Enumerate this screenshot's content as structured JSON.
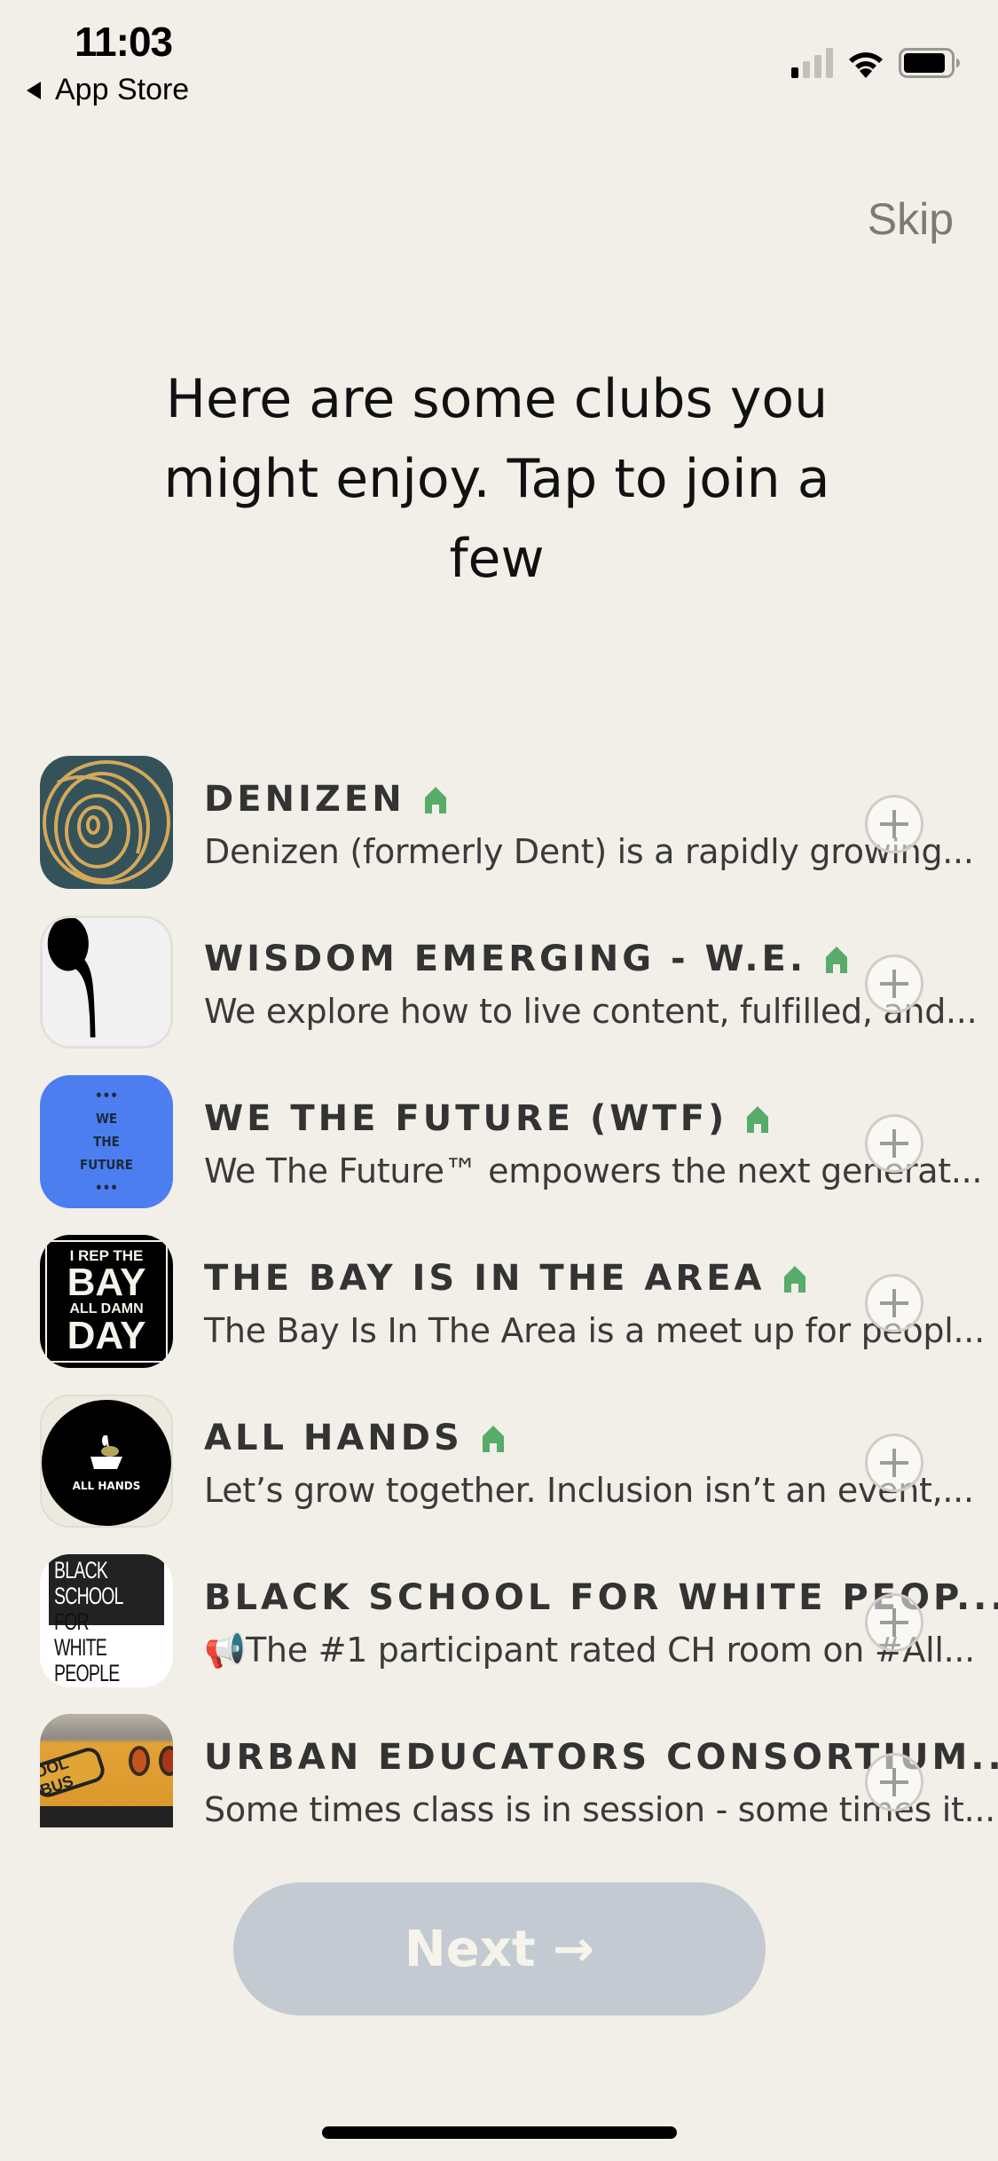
{
  "status_bar": {
    "time": "11:03",
    "back_label": "App Store",
    "signal_bars_on": 1,
    "signal_bars_total": 4,
    "battery_level": 0.8
  },
  "header": {
    "skip_label": "Skip",
    "headline": "Here are some clubs you might enjoy. Tap to join a few"
  },
  "colors": {
    "background": "#f1efe7",
    "accent_green": "#58ac6a",
    "next_disabled": "#c4cad2"
  },
  "clubs": [
    {
      "name": "DENIZEN",
      "description": "Denizen (formerly Dent) is a rapidly growing...",
      "icon": "gold-spiral-logo",
      "badge": "house-icon"
    },
    {
      "name": "WISDOM EMERGING - W.E.",
      "description": "We explore how to live content, fulfilled, and...",
      "icon": "black-sprout-logo",
      "badge": "house-icon"
    },
    {
      "name": "WE THE FUTURE (WTF)",
      "description": "We The Future™ empowers the next generat...",
      "icon": "we-the-future-logo",
      "badge": "house-icon"
    },
    {
      "name": "THE BAY IS IN THE AREA",
      "description": "The Bay Is In The Area is a meet up for peopl...",
      "icon": "rep-the-bay-logo",
      "badge": "house-icon"
    },
    {
      "name": "ALL HANDS",
      "description": "Let’s grow together.  Inclusion isn’t an event,...",
      "icon": "all-hands-logo",
      "badge": "house-icon"
    },
    {
      "name": "BLACK SCHOOL FOR WHITE PEOP...",
      "description": "📢The #1  participant rated CH room on #All...",
      "icon": "black-school-logo",
      "badge": "house-icon"
    },
    {
      "name": "URBAN EDUCATORS CONSORTIUM...",
      "description": "Some times class is in session - some times it...",
      "icon": "school-bus-photo",
      "badge": "house-icon"
    }
  ],
  "logos": {
    "we_the_future": [
      "WE",
      "THE",
      "FUTURE"
    ],
    "bay": [
      "I REP THE",
      "BAY",
      "ALL DAMN",
      "DAY"
    ],
    "all_hands": "ALL HANDS",
    "black_school": [
      "BLACK",
      "SCHOOL",
      "FOR",
      "WHITE",
      "PEOPLE"
    ],
    "bus": "OOL BUS"
  },
  "footer": {
    "next_label": "Next →"
  }
}
